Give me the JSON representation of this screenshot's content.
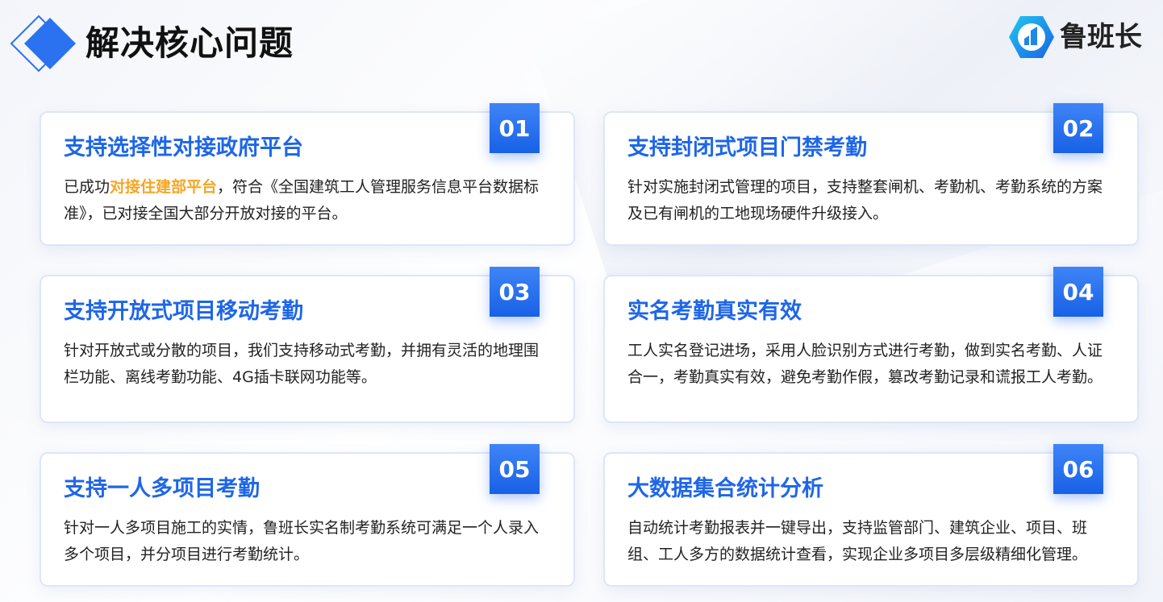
{
  "page": {
    "title": "解决核心问题"
  },
  "brand": {
    "name": "鲁班长"
  },
  "colors": {
    "accent": "#1e66e8",
    "highlight": "#f5a623",
    "badge": "#2a72ef"
  },
  "cards": [
    {
      "number": "01",
      "title": "支持选择性对接政府平台",
      "desc_before": "已成功",
      "desc_highlight": "对接住建部平台",
      "desc_after": "，符合《全国建筑工人管理服务信息平台数据标准》，已对接全国大部分开放对接的平台。"
    },
    {
      "number": "02",
      "title": "支持封闭式项目门禁考勤",
      "desc": "针对实施封闭式管理的项目，支持整套闸机、考勤机、考勤系统的方案及已有闸机的工地现场硬件升级接入。"
    },
    {
      "number": "03",
      "title": "支持开放式项目移动考勤",
      "desc": "针对开放式或分散的项目，我们支持移动式考勤，并拥有灵活的地理围栏功能、离线考勤功能、4G插卡联网功能等。"
    },
    {
      "number": "04",
      "title": "实名考勤真实有效",
      "desc": "工人实名登记进场，采用人脸识别方式进行考勤，做到实名考勤、人证合一，考勤真实有效，避免考勤作假，篡改考勤记录和谎报工人考勤。"
    },
    {
      "number": "05",
      "title": "支持一人多项目考勤",
      "desc": "针对一人多项目施工的实情，鲁班长实名制考勤系统可满足一个人录入多个项目，并分项目进行考勤统计。"
    },
    {
      "number": "06",
      "title": "大数据集合统计分析",
      "desc": "自动统计考勤报表并一键导出，支持监管部门、建筑企业、项目、班组、工人多方的数据统计查看，实现企业多项目多层级精细化管理。"
    }
  ]
}
